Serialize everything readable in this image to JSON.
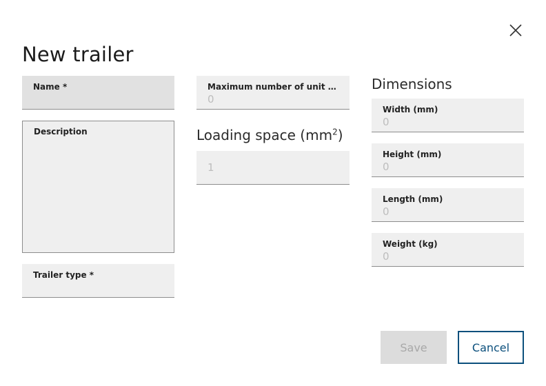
{
  "dialog": {
    "title": "New trailer",
    "close_icon": "close-icon"
  },
  "left": {
    "name": {
      "label": "Name *",
      "value": ""
    },
    "description": {
      "label": "Description",
      "value": ""
    },
    "trailer_type": {
      "label": "Trailer type *",
      "value": ""
    }
  },
  "middle": {
    "max_unit_loads": {
      "label": "Maximum number of unit loa...",
      "value": "0"
    },
    "loading_space": {
      "title": "Loading space (mm",
      "superscript": "2",
      "title_suffix": ")",
      "value": "1"
    }
  },
  "dimensions": {
    "title": "Dimensions",
    "width": {
      "label": "Width (mm)",
      "value": "0"
    },
    "height": {
      "label": "Height (mm)",
      "value": "0"
    },
    "length": {
      "label": "Length (mm)",
      "value": "0"
    },
    "weight": {
      "label": "Weight (kg)",
      "value": "0"
    }
  },
  "footer": {
    "save_label": "Save",
    "cancel_label": "Cancel"
  },
  "colors": {
    "primary": "#0b4f7c",
    "field_bg": "#efefef",
    "disabled_bg": "#dcdcdc"
  }
}
